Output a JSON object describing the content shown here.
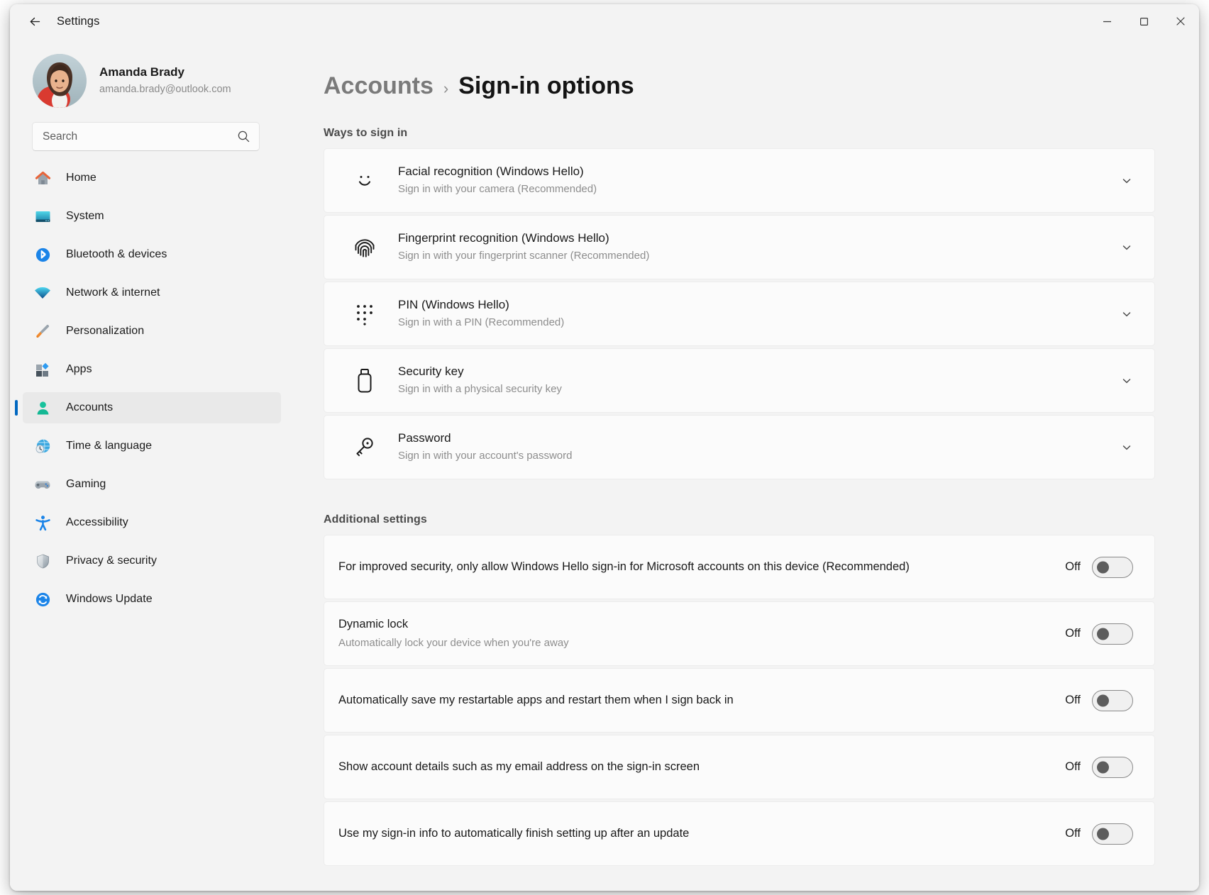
{
  "window": {
    "title": "Settings",
    "back_icon": "back-arrow-icon",
    "minimize_label": "Minimize",
    "maximize_label": "Maximize",
    "close_label": "Close"
  },
  "sidebar": {
    "profile": {
      "name": "Amanda Brady",
      "email": "amanda.brady@outlook.com"
    },
    "search": {
      "placeholder": "Search",
      "value": "",
      "icon": "search-icon"
    },
    "items": [
      {
        "label": "Home",
        "icon": "home-icon",
        "selected": false
      },
      {
        "label": "System",
        "icon": "system-icon",
        "selected": false
      },
      {
        "label": "Bluetooth & devices",
        "icon": "bluetooth-icon",
        "selected": false
      },
      {
        "label": "Network & internet",
        "icon": "wifi-icon",
        "selected": false
      },
      {
        "label": "Personalization",
        "icon": "paintbrush-icon",
        "selected": false
      },
      {
        "label": "Apps",
        "icon": "apps-icon",
        "selected": false
      },
      {
        "label": "Accounts",
        "icon": "accounts-icon",
        "selected": true
      },
      {
        "label": "Time & language",
        "icon": "clock-globe-icon",
        "selected": false
      },
      {
        "label": "Gaming",
        "icon": "gamepad-icon",
        "selected": false
      },
      {
        "label": "Accessibility",
        "icon": "accessibility-icon",
        "selected": false
      },
      {
        "label": "Privacy & security",
        "icon": "shield-icon",
        "selected": false
      },
      {
        "label": "Windows Update",
        "icon": "update-icon",
        "selected": false
      }
    ]
  },
  "main": {
    "breadcrumb": {
      "parent": "Accounts",
      "separator": "›",
      "current": "Sign-in options"
    },
    "ways_to_sign_in": {
      "heading": "Ways to sign in",
      "items": [
        {
          "title": "Facial recognition (Windows Hello)",
          "subtitle": "Sign in with your camera (Recommended)",
          "icon": "face-smile-icon",
          "expand_icon": "chevron-down-icon"
        },
        {
          "title": "Fingerprint recognition (Windows Hello)",
          "subtitle": "Sign in with your fingerprint scanner (Recommended)",
          "icon": "fingerprint-icon",
          "expand_icon": "chevron-down-icon"
        },
        {
          "title": "PIN (Windows Hello)",
          "subtitle": "Sign in with a PIN (Recommended)",
          "icon": "pin-keypad-icon",
          "expand_icon": "chevron-down-icon"
        },
        {
          "title": "Security key",
          "subtitle": "Sign in with a physical security key",
          "icon": "usb-security-key-icon",
          "expand_icon": "chevron-down-icon"
        },
        {
          "title": "Password",
          "subtitle": "Sign in with your account's password",
          "icon": "key-icon",
          "expand_icon": "chevron-down-icon"
        }
      ]
    },
    "additional_settings": {
      "heading": "Additional settings",
      "items": [
        {
          "title": "For improved security, only allow Windows Hello sign-in for Microsoft accounts on this device (Recommended)",
          "subtitle": "",
          "state": "Off"
        },
        {
          "title": "Dynamic lock",
          "subtitle": "Automatically lock your device when you're away",
          "state": "Off"
        },
        {
          "title": "Automatically save my restartable apps and restart them when I sign back in",
          "subtitle": "",
          "state": "Off"
        },
        {
          "title": "Show account details such as my email address on the sign-in screen",
          "subtitle": "",
          "state": "Off"
        },
        {
          "title": "Use my sign-in info to automatically finish setting up after an update",
          "subtitle": "",
          "state": "Off"
        }
      ]
    }
  },
  "colors": {
    "accent": "#0067c0",
    "window_bg": "#f3f3f3",
    "card_bg": "#fbfbfb"
  }
}
